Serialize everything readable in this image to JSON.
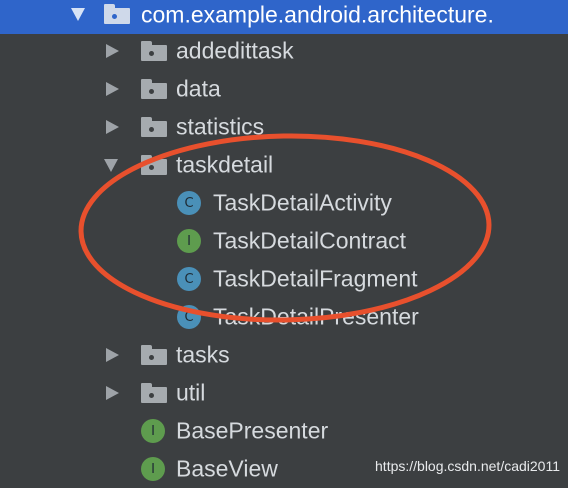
{
  "tree": {
    "package_label": "com.example.android.architecture.",
    "folders": [
      {
        "label": "addedittask"
      },
      {
        "label": "data"
      },
      {
        "label": "statistics"
      },
      {
        "label": "taskdetail"
      }
    ],
    "taskdetail_children": [
      {
        "label": "TaskDetailActivity",
        "kind": "C"
      },
      {
        "label": "TaskDetailContract",
        "kind": "I"
      },
      {
        "label": "TaskDetailFragment",
        "kind": "C"
      },
      {
        "label": "TaskDetailPresenter",
        "kind": "C"
      }
    ],
    "more_folders": [
      {
        "label": "tasks"
      },
      {
        "label": "util"
      }
    ],
    "files": [
      {
        "label": "BasePresenter",
        "kind": "I"
      },
      {
        "label": "BaseView",
        "kind": "I"
      }
    ]
  },
  "watermark": "https://blog.csdn.net/cadi2011",
  "colors": {
    "background": "#3c3f41",
    "selection": "#2f65ca",
    "class_badge": "#4a90b8",
    "interface_badge": "#5e9c4e",
    "annotation": "#e8502d"
  }
}
